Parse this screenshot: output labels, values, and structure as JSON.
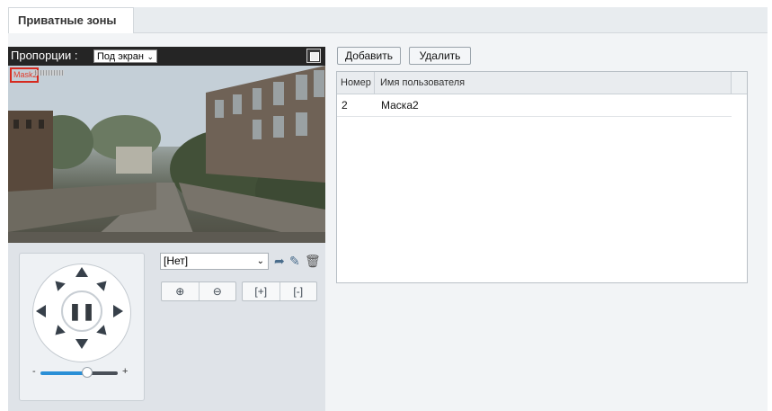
{
  "tab": {
    "label": "Приватные зоны"
  },
  "video": {
    "ratio_label": "Пропорции :",
    "ratio_value": "Под экран",
    "mask_label": "Mask2"
  },
  "ptz": {
    "speed_level": 0.56,
    "speed_minus": "-",
    "speed_plus": "+",
    "pause_icon": "pause-icon"
  },
  "preset": {
    "selected": "[Нет]"
  },
  "toolbar": {
    "add_label": "Добавить",
    "delete_label": "Удалить"
  },
  "table": {
    "columns": [
      "Номер",
      "Имя пользователя"
    ],
    "rows": [
      {
        "num": "2",
        "name": "Маска2"
      }
    ]
  },
  "colors": {
    "mask_border": "#d62a1f",
    "speed_fill": "#2a8fd6",
    "header_bg": "#252525"
  }
}
